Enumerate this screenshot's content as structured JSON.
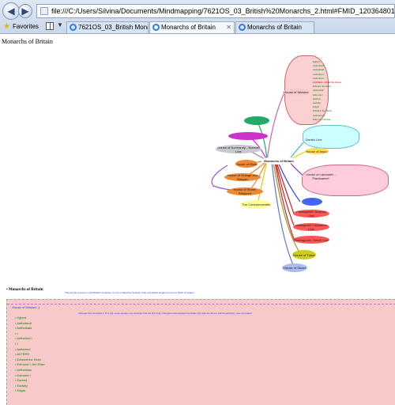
{
  "browser": {
    "address": "file:///C:/Users/Silvina/Documents/Mindmapping/7621OS_03_British%20Monarchs_2.html#FMID_1203648011FM",
    "favorites_label": "Favorites",
    "tabs": [
      {
        "label": "7621OS_03_British Monarchs"
      },
      {
        "label": "Monarchs of Britain"
      },
      {
        "label": "Monarchs of Britain"
      }
    ]
  },
  "page": {
    "title": "Monarchs of Britain",
    "section_title": "• Monarchs of Britain",
    "top_note": "This list has a focus on the British monarchy, so I've omitted the Scottish, Irish and Welsh kingdoms prior to 1603. [1] (Note)",
    "panel_head": "House of Wessex :)",
    "panel_note": "Although this list starts in 871 AD, some people may consider that the first king of England was Edward the Elder who was the first to call himself king. [see (a) below]",
    "panel_items": [
      "• Egbert",
      "• Aethelwulf",
      "• Aethelbald",
      "• I",
      "• Aethelred I",
      "• I",
      "• Aethelred",
      "• ALFRED",
      "• Edward the Elder",
      "• Edmund I, the Elder",
      "• Aethelstan",
      "• Edmund I",
      "• Eadred",
      "• Eadwig",
      "• Edgar"
    ]
  },
  "mindmap": {
    "root": "Monarchs of Britain",
    "nodes": [
      {
        "label": "House of Wessex",
        "color": "#f8c9c9"
      },
      {
        "label": "",
        "color": "#22aa66"
      },
      {
        "label": "",
        "color": "#cc33cc"
      },
      {
        "label": "House of Normandy - Norman Line",
        "color": "#c8c8d0"
      },
      {
        "label": "House of Blois",
        "color": "#ee8833"
      },
      {
        "label": "House of Orange and Nassau",
        "color": "#ee8833"
      },
      {
        "label": "House of Stuart: Restored",
        "color": "#ee8833"
      },
      {
        "label": "The Commonwealth",
        "color": "#ffff99"
      },
      {
        "label": "Danish Line",
        "color": "#ccffff"
      },
      {
        "label": "House of Lancaster - Plantagenet",
        "color": "#ffccdd"
      },
      {
        "label": "House of Anjou",
        "color": "#ffdd55"
      },
      {
        "label": "House of Tudor",
        "color": "#cccc22"
      },
      {
        "label": "House of Stuart",
        "color": "#aabbee"
      },
      {
        "label": "Plantagenet: Angevin Line",
        "color": "#ff5555"
      },
      {
        "label": "Plantagenet: Lancastrian Line",
        "color": "#ff5555"
      },
      {
        "label": "Plantagenet: Yorkist Line",
        "color": "#ff5555"
      },
      {
        "label": "",
        "color": "#4466ee"
      }
    ],
    "wessex_list": [
      "Egbert",
      "Aethelwulf",
      "Aethelbald",
      "Aethelbert",
      "Aethelred I",
      "ALFRED - Alfred the Great",
      "Edward the Elder",
      "Aethelstan",
      "Edmund I",
      "Eadred",
      "Eadwig",
      "Edgar",
      "Edward the Martyr",
      "Aethelred II",
      "Edmund Ironside"
    ]
  }
}
